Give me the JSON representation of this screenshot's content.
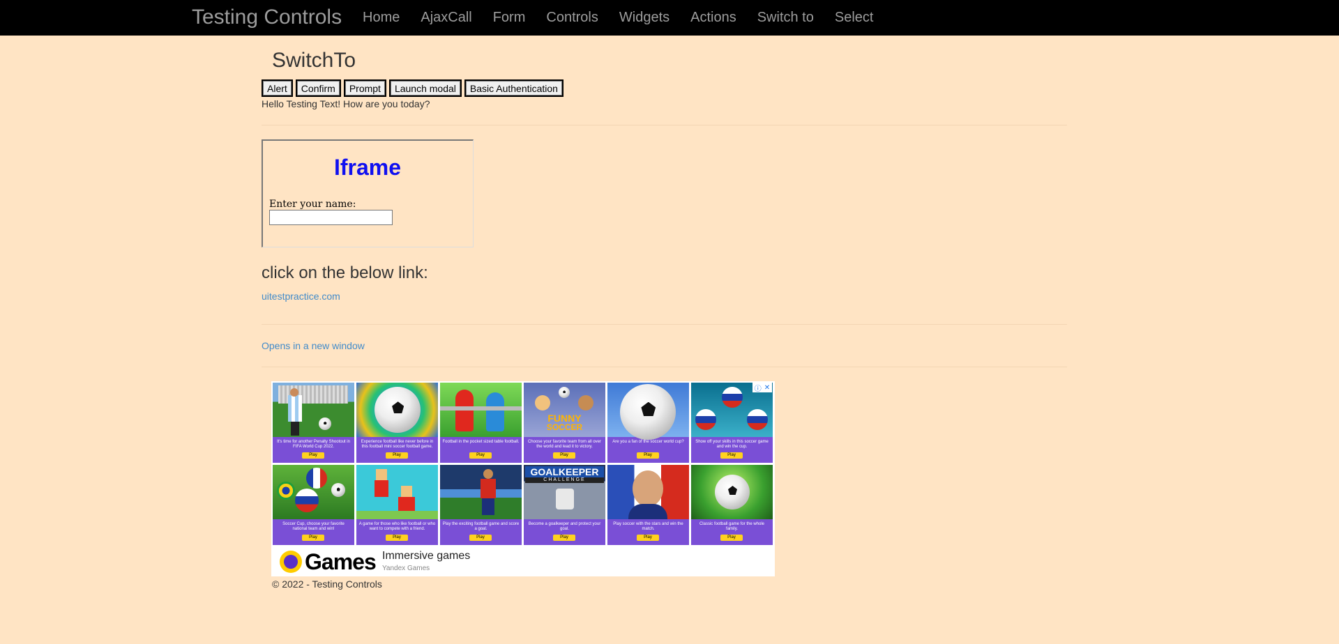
{
  "nav": {
    "brand": "Testing Controls",
    "items": [
      "Home",
      "AjaxCall",
      "Form",
      "Controls",
      "Widgets",
      "Actions",
      "Switch to",
      "Select"
    ]
  },
  "page": {
    "title": "SwitchTo",
    "buttons": [
      "Alert",
      "Confirm",
      "Prompt",
      "Launch modal",
      "Basic Authentication"
    ],
    "greeting": "Hello Testing Text! How are you today?"
  },
  "iframe": {
    "title": "Iframe",
    "label": "Enter your name:",
    "input_value": ""
  },
  "links": {
    "heading": "click on the below link:",
    "site_link": "uitestpractice.com",
    "new_window_link": "Opens in a new window"
  },
  "ad": {
    "tiles": [
      {
        "caption": "It's time for another Penalty Shootout in FIFA World Cup 2022.",
        "play": "Play"
      },
      {
        "caption": "Experience football like never before in this football mini soccer football game.",
        "play": "Play"
      },
      {
        "caption": "Football in the pocket sized table football.",
        "play": "Play"
      },
      {
        "caption": "Choose your favorite team from all over the world and lead it to victory.",
        "play": "Play"
      },
      {
        "caption": "Are you a fan of the soccer world cup?",
        "play": "Play"
      },
      {
        "caption": "Show off your skills in this soccer game and win the cup.",
        "play": "Play"
      },
      {
        "caption": "Soccer Cup, choose your favorite national team and win!",
        "play": "Play"
      },
      {
        "caption": "A game for those who like football or who want to compete with a friend.",
        "play": "Play"
      },
      {
        "caption": "Play the exciting football game and score a goal.",
        "play": "Play"
      },
      {
        "caption": "Become a goalkeeper and protect your goal.",
        "play": "Play"
      },
      {
        "caption": "Play soccer with the stars and win the match.",
        "play": "Play"
      },
      {
        "caption": "Classic football game for the whole family.",
        "play": "Play"
      }
    ],
    "goalkeeper_text": "GOALKEEPER",
    "goalkeeper_sub": "CHALLENGE",
    "funny_text": "FUNNY",
    "funny_sub": "SOCCER",
    "brand": "Games",
    "headline": "Immersive games",
    "sub": "Yandex Games",
    "adchoices_info": "ⓘ",
    "adchoices_close": "✕"
  },
  "footer": "© 2022 - Testing Controls"
}
